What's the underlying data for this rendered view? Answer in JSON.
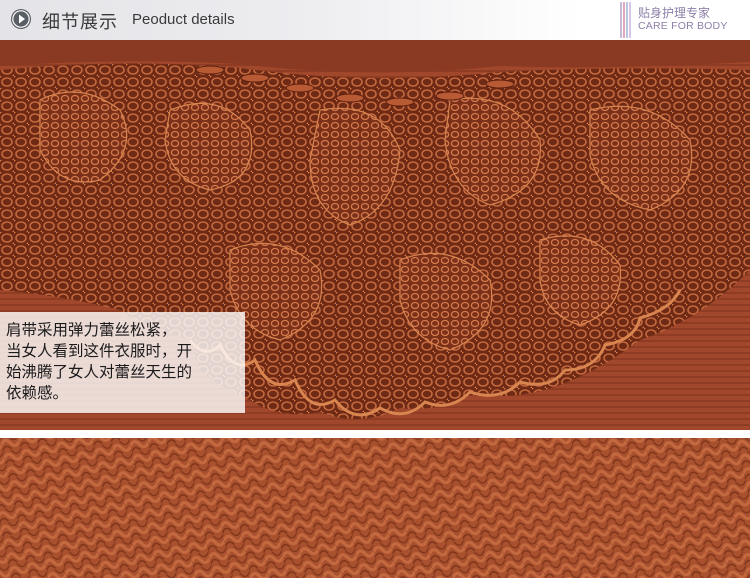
{
  "header": {
    "icon": "play-circle-icon",
    "title_cn": "细节展示",
    "title_en": "Peoduct details"
  },
  "brand": {
    "name_cn": "贴身护理专家",
    "name_en": "CARE FOR BODY"
  },
  "caption": {
    "text": "肩带采用弹力蕾丝松紧，\n当女人看到这件衣服时，开\n始沸腾了女人对蕾丝天生的\n依赖感。"
  },
  "colors": {
    "fabric": "#a1472b",
    "fabric_dark": "#6e2a15",
    "fabric_light": "#c06a44",
    "brand_purple": "#8d7fa8"
  }
}
